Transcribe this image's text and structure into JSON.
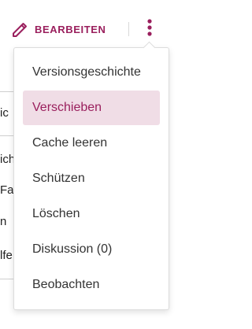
{
  "toolbar": {
    "edit_label": "BEARBEITEN",
    "edit_icon": "pencil-icon",
    "more_icon": "vertical-ellipsis-icon"
  },
  "background_fragments": [
    "ic",
    "ich",
    "Fa",
    "n",
    "lfe"
  ],
  "menu": {
    "items": [
      {
        "label": "Versionsgeschichte"
      },
      {
        "label": "Verschieben",
        "active": true
      },
      {
        "label": "Cache leeren"
      },
      {
        "label": "Schützen"
      },
      {
        "label": "Löschen"
      },
      {
        "label": "Diskussion (0)"
      },
      {
        "label": "Beobachten"
      }
    ]
  },
  "colors": {
    "accent": "#9a1f5d",
    "active_bg": "#f0dde6",
    "text": "#333333",
    "border": "#dcdcdc"
  }
}
